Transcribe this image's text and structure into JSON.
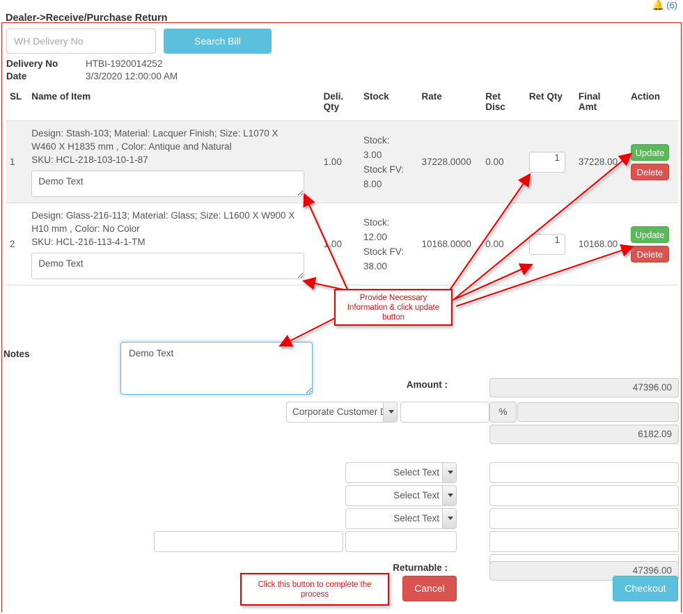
{
  "topbar": {
    "bell_icon": "bell-icon",
    "count": "(6)"
  },
  "page_title": "Dealer->Receive/Purchase Return",
  "search": {
    "placeholder": "WH Delivery No",
    "value": "",
    "button_label": "Search Bill"
  },
  "meta": {
    "delivery_no_label": "Delivery No",
    "delivery_no_value": "HTBI-1920014252",
    "date_label": "Date",
    "date_value": "3/3/2020 12:00:00 AM"
  },
  "table": {
    "headers": {
      "sl": "SL",
      "name": "Name of Item",
      "deli_qty": "Deli. Qty",
      "deli_qty_l1": "Deli.",
      "deli_qty_l2": "Qty",
      "stock": "Stock",
      "rate": "Rate",
      "ret_disc_l1": "Ret",
      "ret_disc_l2": "Disc",
      "ret_qty": "Ret Qty",
      "final_amt_l1": "Final",
      "final_amt_l2": "Amt",
      "action": "Action"
    },
    "rows": [
      {
        "sl": "1",
        "desc_line1": "Design: Stash-103; Material: Lacquer Finish; Size: L1070 X",
        "desc_line2": "W460 X H1835 mm , Color: Antique and Natural",
        "desc_line3": "SKU: HCL-218-103-10-1-87",
        "note_value": "Demo Text",
        "deli_qty": "1.00",
        "stock_label": "Stock:",
        "stock_value": "3.00",
        "stock_fv_label": "Stock FV:",
        "stock_fv_value": "8.00",
        "rate": "37228.0000",
        "ret_disc": "0.00",
        "ret_qty": "1",
        "final_amt": "37228.00",
        "update_label": "Update",
        "delete_label": "Delete"
      },
      {
        "sl": "2",
        "desc_line1": "Design: Glass-216-113; Material: Glass; Size: L1600 X W900 X",
        "desc_line2": "H10 mm , Color: No Color",
        "desc_line3": "SKU: HCL-216-113-4-1-TM",
        "note_value": "Demo Text",
        "deli_qty": "1.00",
        "stock_label": "Stock:",
        "stock_value": "12.00",
        "stock_fv_label": "Stock FV:",
        "stock_fv_value": "38.00",
        "rate": "10168.0000",
        "ret_disc": "0.00",
        "ret_qty": "1",
        "final_amt": "10168.00",
        "update_label": "Update",
        "delete_label": "Delete"
      }
    ]
  },
  "notes": {
    "label": "Notes",
    "value": "Demo Text"
  },
  "summary": {
    "amount_label": "Amount :",
    "amount_value": "47396.00",
    "discount_select_value": "Corporate Customer D",
    "discount_input_value": "",
    "percent_symbol": "%",
    "discount_amount_value": "",
    "net_value": "6182.09",
    "select_text_1": "Select Text",
    "select_text_2": "Select Text",
    "select_text_3": "Select Text",
    "extra_field_left": "",
    "extra_field_right": "",
    "blank_1": "",
    "blank_2": "",
    "blank_3": "",
    "blank_4": "",
    "blank_5": "",
    "returnable_label": "Returnable :",
    "returnable_value": "47396.00"
  },
  "actions": {
    "cancel_label": "Cancel",
    "checkout_label": "Checkout"
  },
  "annotations": {
    "update_hint": "Provide Necessary Information & click update button",
    "checkout_hint": "Click this button to complete the process"
  },
  "colors": {
    "info_blue": "#5bc0de",
    "success_green": "#5cb85c",
    "danger_red": "#d9534f",
    "annotation_red": "#ee0000",
    "border_red": "#e8211c",
    "focus_blue": "#66afe9"
  }
}
